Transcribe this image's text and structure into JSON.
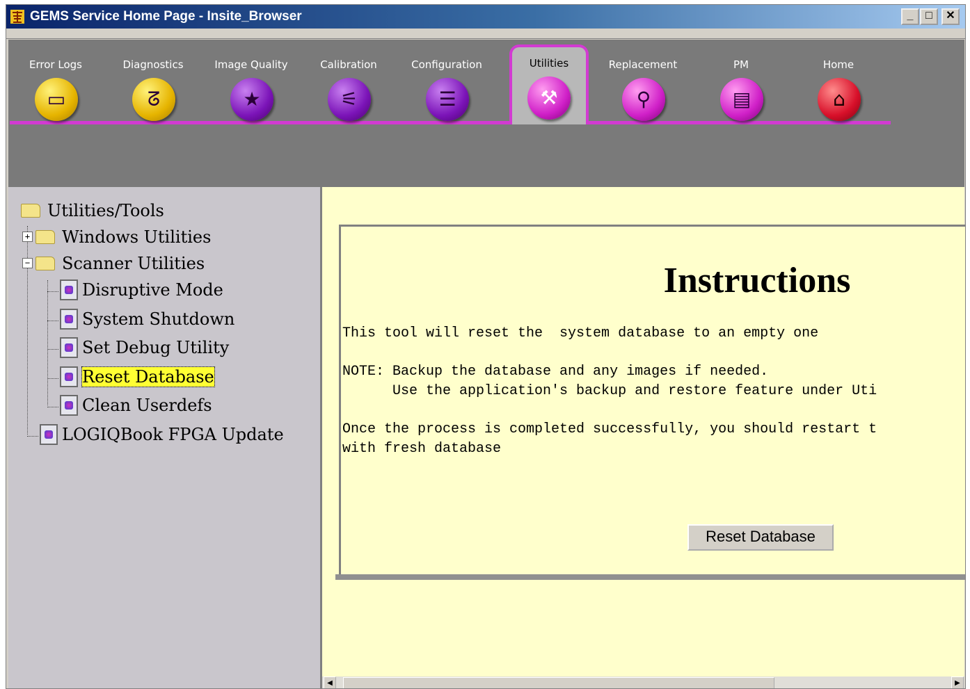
{
  "window": {
    "title": "GEMS Service Home Page - Insite_Browser",
    "buttons": {
      "minimize": "_",
      "maximize": "□",
      "close": "✕"
    }
  },
  "nav": {
    "accent_color": "#d23ad2",
    "tabs": [
      {
        "label": "Error Logs",
        "icon": "log-icon",
        "color": "yellow",
        "active": false
      },
      {
        "label": "Diagnostics",
        "icon": "stethoscope-icon",
        "color": "yellow",
        "active": false
      },
      {
        "label": "Image Quality",
        "icon": "image-quality-icon",
        "color": "purple",
        "active": false
      },
      {
        "label": "Calibration",
        "icon": "calibration-icon",
        "color": "purple",
        "active": false
      },
      {
        "label": "Configuration",
        "icon": "configuration-icon",
        "color": "purple",
        "active": false
      },
      {
        "label": "Utilities",
        "icon": "toolbox-icon",
        "color": "magenta",
        "active": true
      },
      {
        "label": "Replacement",
        "icon": "wrench-icon",
        "color": "magenta",
        "active": false
      },
      {
        "label": "PM",
        "icon": "clipboard-icon",
        "color": "magenta",
        "active": false
      },
      {
        "label": "Home",
        "icon": "home-icon",
        "color": "red",
        "active": false
      }
    ]
  },
  "tree": {
    "root": "Utilities/Tools",
    "windows_utilities": "Windows Utilities",
    "scanner_utilities": "Scanner Utilities",
    "items": [
      "Disruptive Mode",
      "System Shutdown",
      "Set Debug Utility",
      "Reset Database",
      "Clean Userdefs"
    ],
    "selected": "Reset Database",
    "logiqbook": "LOGIQBook FPGA Update",
    "expand_plus": "+",
    "expand_minus": "−"
  },
  "content": {
    "title": "Instructions",
    "line1": "This tool will reset the  system database to an empty one",
    "line2": "NOTE: Backup the database and any images if needed.",
    "line3": "      Use the application's backup and restore feature under Uti",
    "line4": "Once the process is completed successfully, you should restart t",
    "line5": "with fresh database",
    "button": "Reset Database"
  },
  "scrollbar": {
    "left": "◀",
    "right": "▶"
  }
}
